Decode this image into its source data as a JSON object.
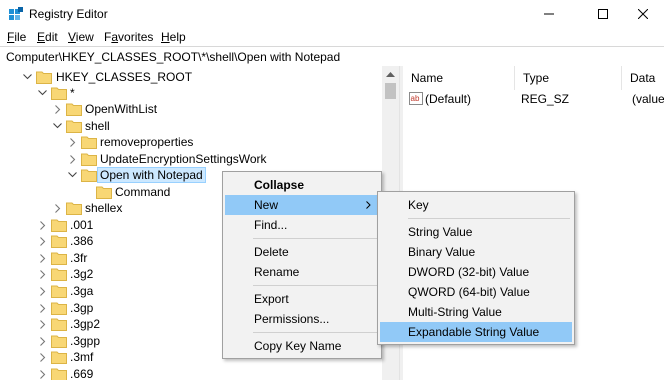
{
  "window": {
    "title": "Registry Editor"
  },
  "menubar": {
    "items": [
      {
        "underline": "F",
        "rest": "ile"
      },
      {
        "underline": "E",
        "rest": "dit"
      },
      {
        "underline": "V",
        "rest": "iew"
      },
      {
        "underline": "F",
        "rest": "avorites",
        "prefix": ""
      },
      {
        "underline": "H",
        "rest": "elp"
      }
    ],
    "favorites_prefix": "F",
    "favorites_underline": "a",
    "favorites_rest": "vorites"
  },
  "address": {
    "path": "Computer\\HKEY_CLASSES_ROOT\\*\\shell\\Open with Notepad"
  },
  "tree": {
    "root": "HKEY_CLASSES_ROOT",
    "star": "*",
    "openwithlist": "OpenWithList",
    "shell": "shell",
    "removeproperties": "removeproperties",
    "updateencryption": "UpdateEncryptionSettingsWork",
    "open_with_notepad": "Open with Notepad",
    "command": "Command",
    "shellex": "shellex",
    "extensions": [
      ".001",
      ".386",
      ".3fr",
      ".3g2",
      ".3ga",
      ".3gp",
      ".3gp2",
      ".3gpp",
      ".3mf",
      ".669"
    ]
  },
  "list": {
    "columns": [
      "Name",
      "Type",
      "Data"
    ],
    "rows": [
      {
        "name": "(Default)",
        "type": "REG_SZ",
        "data": "(value"
      }
    ]
  },
  "context_menu": {
    "collapse": "Collapse",
    "new": "New",
    "find": "Find...",
    "delete": "Delete",
    "rename": "Rename",
    "export": "Export",
    "permissions": "Permissions...",
    "copy_key_name": "Copy Key Name"
  },
  "submenu": {
    "key": "Key",
    "string_value": "String Value",
    "binary_value": "Binary Value",
    "dword": "DWORD (32-bit) Value",
    "qword": "QWORD (64-bit) Value",
    "multi_string": "Multi-String Value",
    "expandable_string": "Expandable String Value"
  },
  "colors": {
    "highlight": "#91c9f7",
    "selection": "#cce8ff",
    "folder": "#f8d775"
  }
}
